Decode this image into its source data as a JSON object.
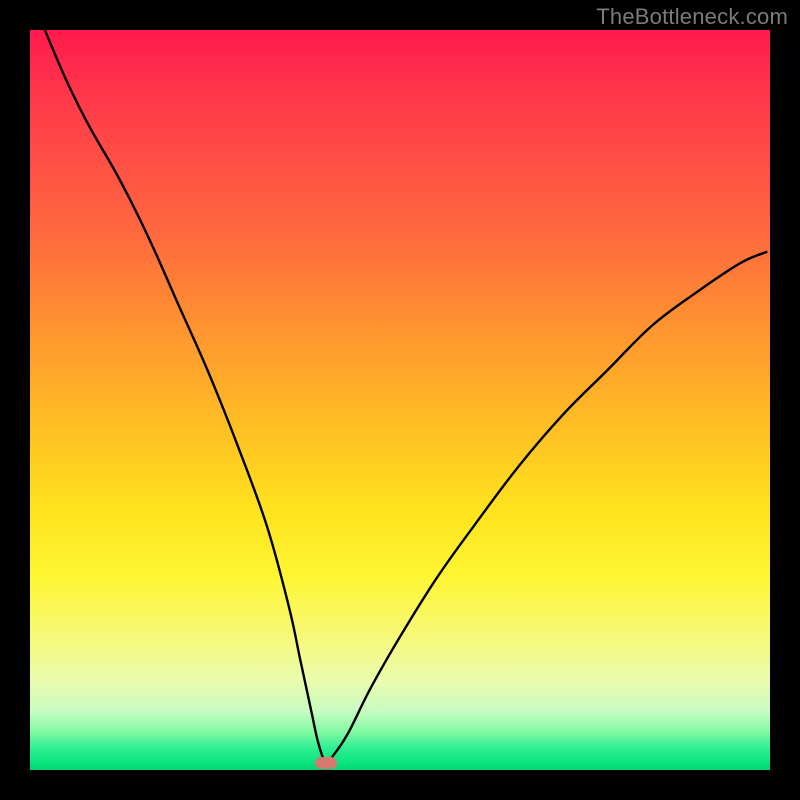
{
  "watermark": "TheBottleneck.com",
  "colors": {
    "frame": "#000000",
    "gradient_top": "#ff1a4d",
    "gradient_mid": "#ffe31e",
    "gradient_bottom": "#04d36f",
    "curve": "#000000",
    "marker": "#d6796f"
  },
  "chart_data": {
    "type": "line",
    "title": "",
    "xlabel": "",
    "ylabel": "",
    "xlim": [
      0,
      100
    ],
    "ylim": [
      0,
      100
    ],
    "grid": false,
    "annotations": [
      "TheBottleneck.com"
    ],
    "series": [
      {
        "name": "bottleneck-curve",
        "x": [
          2,
          5,
          8,
          12,
          16,
          20,
          24,
          28,
          32,
          35,
          36.5,
          38,
          39,
          40,
          41,
          43,
          46,
          50,
          55,
          60,
          66,
          72,
          78,
          84,
          90,
          96,
          99.5
        ],
        "y": [
          100,
          93,
          87,
          80,
          72,
          63,
          54,
          44,
          33,
          22,
          15,
          8,
          3.5,
          1,
          2,
          5,
          11,
          18,
          26,
          33,
          41,
          48,
          54,
          60,
          64.5,
          68.5,
          70
        ]
      }
    ],
    "marker": {
      "x": 40,
      "y": 1
    }
  }
}
